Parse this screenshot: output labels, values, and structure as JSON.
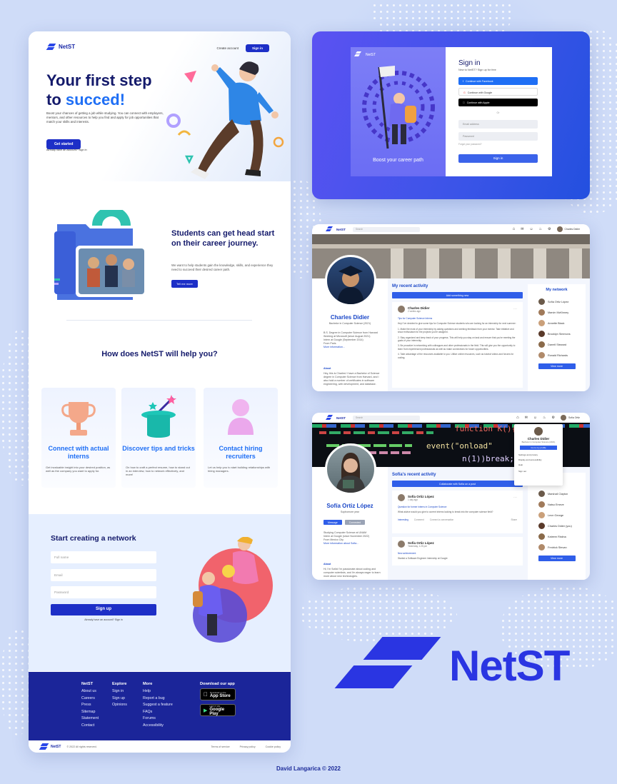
{
  "brand": {
    "name": "NetST",
    "accent": "#1f6ff5",
    "navy": "#1b2599"
  },
  "landing": {
    "nav": {
      "create_account": "Create account",
      "sign_in": "Sign in"
    },
    "hero": {
      "title_1": "Your first step",
      "title_2a": "to ",
      "title_2b": "succed!",
      "subtitle": "Boost your chances of getting a job while studying. You can connect with employers, mentors, and other resources to help you find and apply for job opportunities that match your skills and interests.",
      "button": "Get started",
      "link": "Already have an account? Sign in"
    },
    "section2": {
      "title": "Students can get head start on their career journey.",
      "subtitle": "We want to help students gain the knowledge, skills, and experience they need to succeed their desired career path.",
      "button": "Tell me more"
    },
    "help_title": "How does NetST will help you?",
    "cards": [
      {
        "title": "Connect with actual interns",
        "text": "Get invaluable insight into your desired position, as well as the company you want to apply for."
      },
      {
        "title": "Discover tips and tricks",
        "text": "On how to craft a perfect resume, how to stand out in an interview, how to network effectively, and more!"
      },
      {
        "title": "Contact hiring recruiters",
        "text": "Let us help you to start building relationships with hiring managers."
      }
    ],
    "network": {
      "title": "Start creating a network",
      "full_name": "Full name",
      "email": "Email",
      "password": "Password",
      "button": "Sign up",
      "link": "Already have an account? Sign in"
    },
    "footer": {
      "col1": {
        "heading": "NetST",
        "items": [
          "About us",
          "Careers",
          "Press",
          "Sitemap",
          "Statement",
          "Contact"
        ]
      },
      "col2": {
        "heading": "Explore",
        "items": [
          "Sign in",
          "Sign up",
          "Opinions"
        ]
      },
      "col3": {
        "heading": "More",
        "items": [
          "Help",
          "Report a bug",
          "Suggest a feature",
          "FAQs",
          "Forums",
          "Accessibility"
        ]
      },
      "download": "Download our app",
      "app_store_small": "Download on the",
      "app_store": "App Store",
      "google_small": "GET IT ON",
      "google": "Google Play",
      "copyright": "© 2022 All rights reserved.",
      "links": [
        "Terms of service",
        "Privacy policy",
        "Cookie policy"
      ]
    }
  },
  "signin": {
    "brand": "NetST",
    "tagline": "Boost your career path",
    "title": "Sign in",
    "sub": "New to NetST? Sign up for free",
    "facebook": "Continue with Facebook",
    "google": "Continue with Google",
    "apple": "Continue with Apple",
    "or": "Or",
    "email": "Email address",
    "password": "Password",
    "forgot": "Forgot your password?",
    "button": "Sign in"
  },
  "profile1": {
    "search": "Search",
    "me": "Charles Didier",
    "name": "Charles Didier",
    "role": "Bachelor in Computer Science (2021)",
    "info": [
      "B.S. Degree in Computer Science from Harvard",
      "Working at Microsoft (since August 2021)",
      "Intern at Google (September 2014)",
      "From Paris",
      "More information..."
    ],
    "about_h": "About",
    "about": "Hey, this is Charles! I have a Bachelor of Science degree in Computer Science from Harvard, and I also hold a number of certificates in software engineering, web development, and database.",
    "activity": "My recent activity",
    "add": "Add something new",
    "post": {
      "author": "Charles Didier",
      "time": "2 weeks ago",
      "title": "Tips for Computer Science Interns",
      "paras": [
        "Hey! I've decided to give some tips for Computer Science students who are looking for an internship for next summer:",
        "1. Make the most of your internship by asking questions and seeking feedback from your mentor. Take initiative and show enthusiasm for the projects you're assigned.",
        "2. Stay organized and keep track of your progress. This will help you stay on task and ensure that you're meeting the goals of your internship.",
        "3. Be proactive in networking with colleagues and other professionals in the field. This will give you the opportunity to learn from experienced professionals as well as make connections for future opportunities.",
        "4. Take advantage of the resources available to you. Utilize online resources, such as tutorial videos and forums for coding."
      ]
    },
    "network_title": "My network",
    "friends": [
      "Sofía Ortiz López",
      "Marvin McKinney",
      "Annette Black",
      "Brooklyn Simmons",
      "Darrell Steward",
      "Ronald Richards"
    ],
    "view_more": "View more"
  },
  "profile2": {
    "search": "Search",
    "me": "Sofía Ortiz",
    "name": "Sofía Ortiz López",
    "role": "Sophomore year",
    "message": "Message",
    "connected": "Connected",
    "info": [
      "Studying Computer Science at UNAM",
      "Intern at Google (since November 2022)",
      "From Mexico City",
      "More information about Sofia..."
    ],
    "about_h": "About",
    "about": "Hi, I'm Sofía! I'm passionate about coding and computer scientists, and I'm always eager to learn more about new technologies.",
    "activity": "Sofía's recent activity",
    "collab": "Collaborate with Sofía on a post",
    "post1": {
      "author": "Sofía Ortiz López",
      "time": "1 day ago",
      "title": "Question for former interns in Computer Science",
      "text": "What advice would you give to current interns looking to break into the computer science field?",
      "interesting": "Interesting",
      "comment": "Comment",
      "connect": "Connect a conversation",
      "share": "Share"
    },
    "post2": {
      "author": "Sofía Ortiz López",
      "time": "Yesterday, 1:25 pm",
      "title": "New achievement",
      "text": "Started a Software Engineer Internship at Google"
    },
    "menu": {
      "name": "Charles Didier",
      "role": "Bachelor in Computer Science (2021)",
      "button": "Go to my profile",
      "items": [
        "Settings and privacy",
        "Display and accessibility",
        "Help",
        "Sign out"
      ]
    },
    "friends": [
      "Marshall Clayton",
      "Natsu Emeve",
      "Leon George",
      "Charles Didier (you)",
      "Kateem Ristina",
      "Fredrick Stevan"
    ],
    "view_more": "View more"
  },
  "code_banner": [
    "function K(){",
    "event(\"onload\"",
    "n(1))break;"
  ],
  "big_logo": "NetST",
  "credit": "David Langarica © 2022"
}
